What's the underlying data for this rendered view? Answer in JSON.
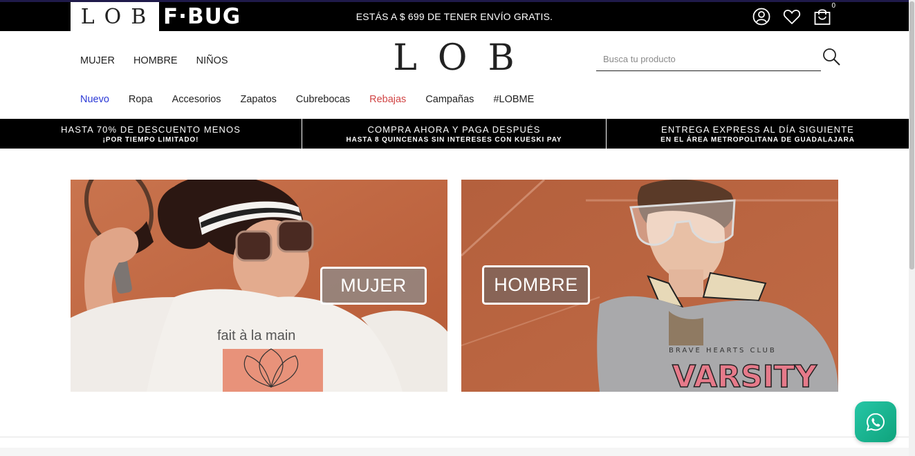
{
  "topbar": {
    "brand_lob": "LOB",
    "brand_fbug": "F·BUG",
    "promo": "ESTÁS A $ 699 DE TENER ENVÍO GRATIS.",
    "cart_count": "0"
  },
  "header": {
    "logo": "LOB",
    "gender_nav": [
      "MUJER",
      "HOMBRE",
      "NIÑOS"
    ],
    "search_placeholder": "Busca tu producto"
  },
  "categories": [
    {
      "label": "Nuevo",
      "color": "#2b39d6"
    },
    {
      "label": "Ropa",
      "color": "#222222"
    },
    {
      "label": "Accesorios",
      "color": "#222222"
    },
    {
      "label": "Zapatos",
      "color": "#222222"
    },
    {
      "label": "Cubrebocas",
      "color": "#222222"
    },
    {
      "label": "Rebajas",
      "color": "#d14545"
    },
    {
      "label": "Campañas",
      "color": "#222222"
    },
    {
      "label": "#LOBME",
      "color": "#222222"
    }
  ],
  "benefits": [
    {
      "title": "HASTA 70% DE DESCUENTO MENOS",
      "subtitle": "¡POR TIEMPO LIMITADO!"
    },
    {
      "title": "COMPRA AHORA Y PAGA DESPUÉS",
      "subtitle": "HASTA 8 QUINCENAS SIN INTERESES CON KUESKI PAY"
    },
    {
      "title": "ENTREGA EXPRESS AL DÍA SIGUIENTE",
      "subtitle": "EN EL ÁREA METROPOLITANA DE GUADALAJARA"
    }
  ],
  "banners": {
    "women": {
      "button": "MUJER",
      "shirt_text": "fait à la main"
    },
    "men": {
      "button": "HOMBRE",
      "shirt_text": "VARSITY"
    }
  },
  "icons": {
    "user": "user-icon",
    "wishlist": "heart-icon",
    "cart": "cart-icon",
    "search": "search-icon",
    "chat": "whatsapp-icon"
  }
}
